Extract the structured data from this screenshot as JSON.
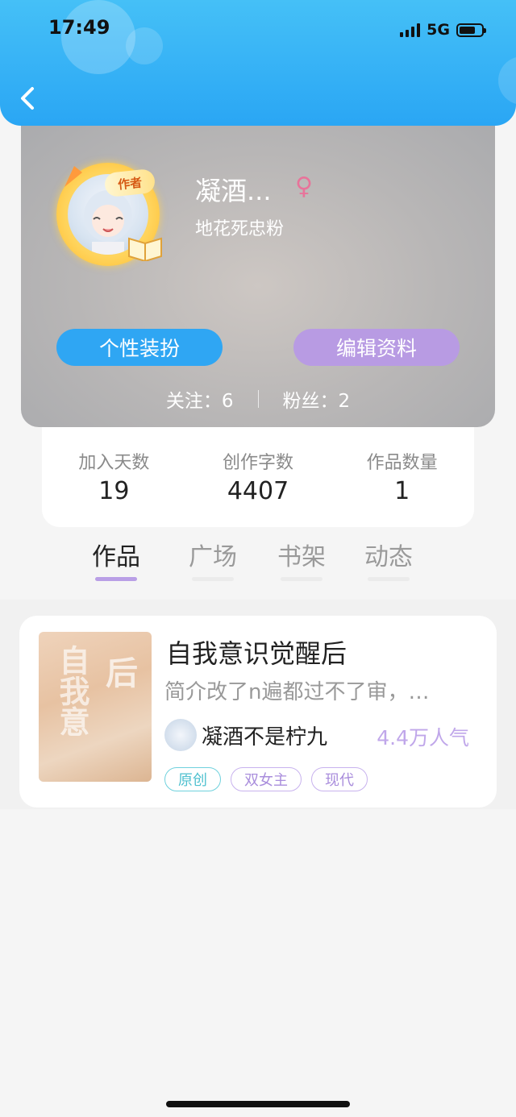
{
  "status_bar": {
    "time": "17:49",
    "network": "5G"
  },
  "profile": {
    "author_badge": "作者",
    "name": "凝酒...",
    "gender_symbol": "♀",
    "signature": "地花死忠粉",
    "buttons": {
      "style": "个性装扮",
      "edit": "编辑资料"
    },
    "follow_text": "关注：6",
    "fans_text": "粉丝：2"
  },
  "stats": [
    {
      "label": "加入天数",
      "value": "19"
    },
    {
      "label": "创作字数",
      "value": "4407"
    },
    {
      "label": "作品数量",
      "value": "1"
    }
  ],
  "tabs": [
    {
      "label": "作品",
      "active": true
    },
    {
      "label": "广场",
      "active": false
    },
    {
      "label": "书架",
      "active": false
    },
    {
      "label": "动态",
      "active": false
    }
  ],
  "work": {
    "cover_text_left": "自我意",
    "cover_text_right": "识觉醒后",
    "title": "自我意识觉醒后",
    "description": "简介改了n遍都过不了审，…",
    "author": "凝酒不是柠九",
    "popularity": "4.4万人气",
    "tags": [
      "原创",
      "双女主",
      "现代"
    ]
  },
  "colors": {
    "header_blue": "#2aa6f4",
    "style_button": "#2fa6f3",
    "edit_button": "#b89be3",
    "active_tab_underline": "#b99fe6",
    "popularity": "#c0a7ea"
  }
}
